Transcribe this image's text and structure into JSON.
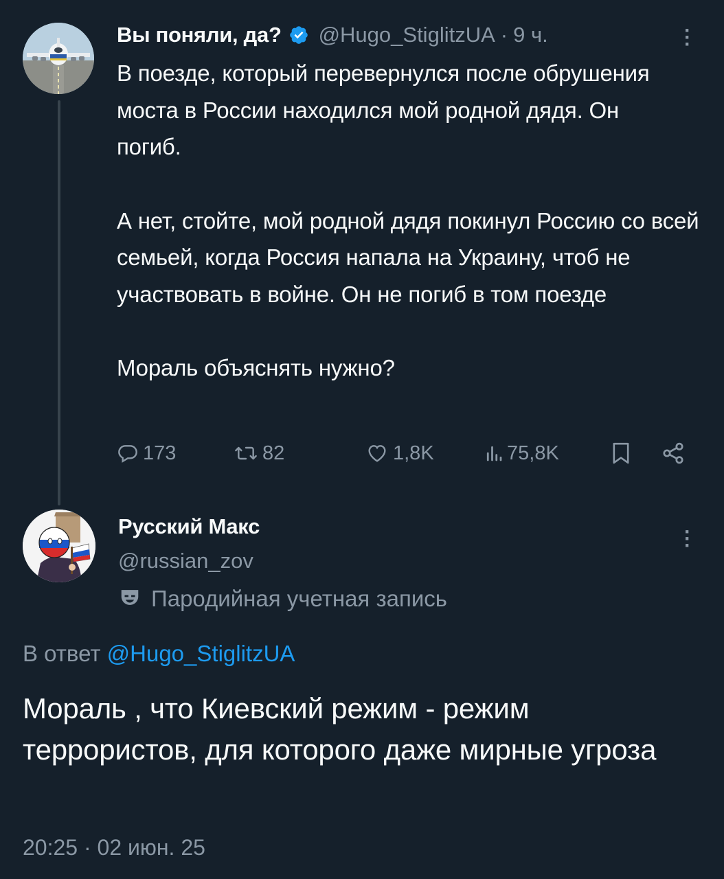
{
  "original_tweet": {
    "display_name": "Вы поняли, да?",
    "verified": true,
    "handle": "@Hugo_StiglitzUA",
    "separator": "·",
    "time_ago": "9 ч.",
    "paragraphs": [
      "В поезде, который перевернулся после обрушения моста в России находился мой родной дядя. Он погиб.",
      "А нет, стойте, мой родной дядя покинул Россию со всей семьей, когда Россия напала на Украину, чтоб не участвовать в войне. Он не погиб в том поезде",
      "Мораль объяснять нужно?"
    ],
    "actions": {
      "replies": "173",
      "retweets": "82",
      "likes": "1,8K",
      "views": "75,8K"
    },
    "avatar_icon": "airplane-avatar"
  },
  "reply_tweet": {
    "display_name": "Русский Макс",
    "handle": "@russian_zov",
    "parody_label": "Пародийная учетная запись",
    "replying_prefix": "В ответ",
    "replying_to": "@Hugo_StiglitzUA",
    "text": "Мораль , что Киевский режим - режим террористов, для которого даже мирные угроза",
    "time": "20:25",
    "separator": "·",
    "date": "02 июн. 25",
    "avatar_icon": "countryball-avatar"
  },
  "colors": {
    "background": "#15202b",
    "text": "#f7f9f9",
    "secondary": "#8b98a5",
    "accent": "#1d9bf0",
    "thread_line": "#38444d"
  }
}
